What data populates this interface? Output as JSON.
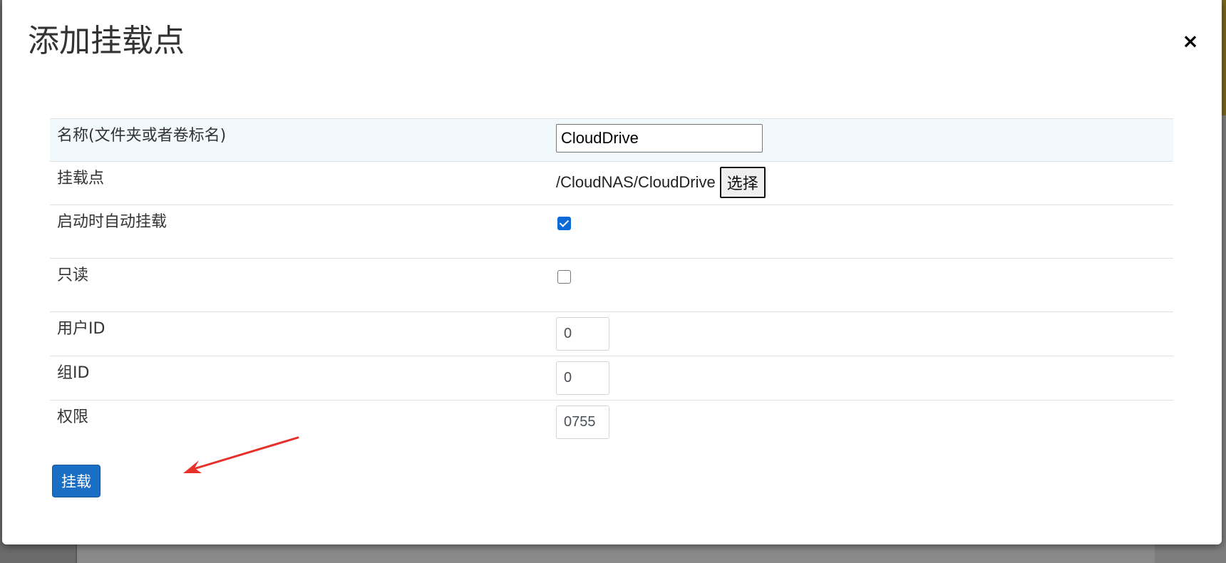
{
  "dialog": {
    "title": "添加挂载点",
    "close_symbol": "×"
  },
  "form": {
    "name": {
      "label": "名称(文件夹或者卷标名)",
      "value": "CloudDrive"
    },
    "mount_point": {
      "label": "挂载点",
      "path": "/CloudNAS/CloudDrive",
      "select_label": "选择"
    },
    "auto_mount": {
      "label": "启动时自动挂载",
      "checked": true
    },
    "read_only": {
      "label": "只读",
      "checked": false
    },
    "user_id": {
      "label": "用户ID",
      "value": "0"
    },
    "group_id": {
      "label": "组ID",
      "value": "0"
    },
    "permission": {
      "label": "权限",
      "value": "0755"
    }
  },
  "actions": {
    "mount_label": "挂载"
  },
  "colors": {
    "primary": "#1a6fc4",
    "striped_row": "#f2f9fd",
    "annotation_arrow": "#e8302a"
  }
}
